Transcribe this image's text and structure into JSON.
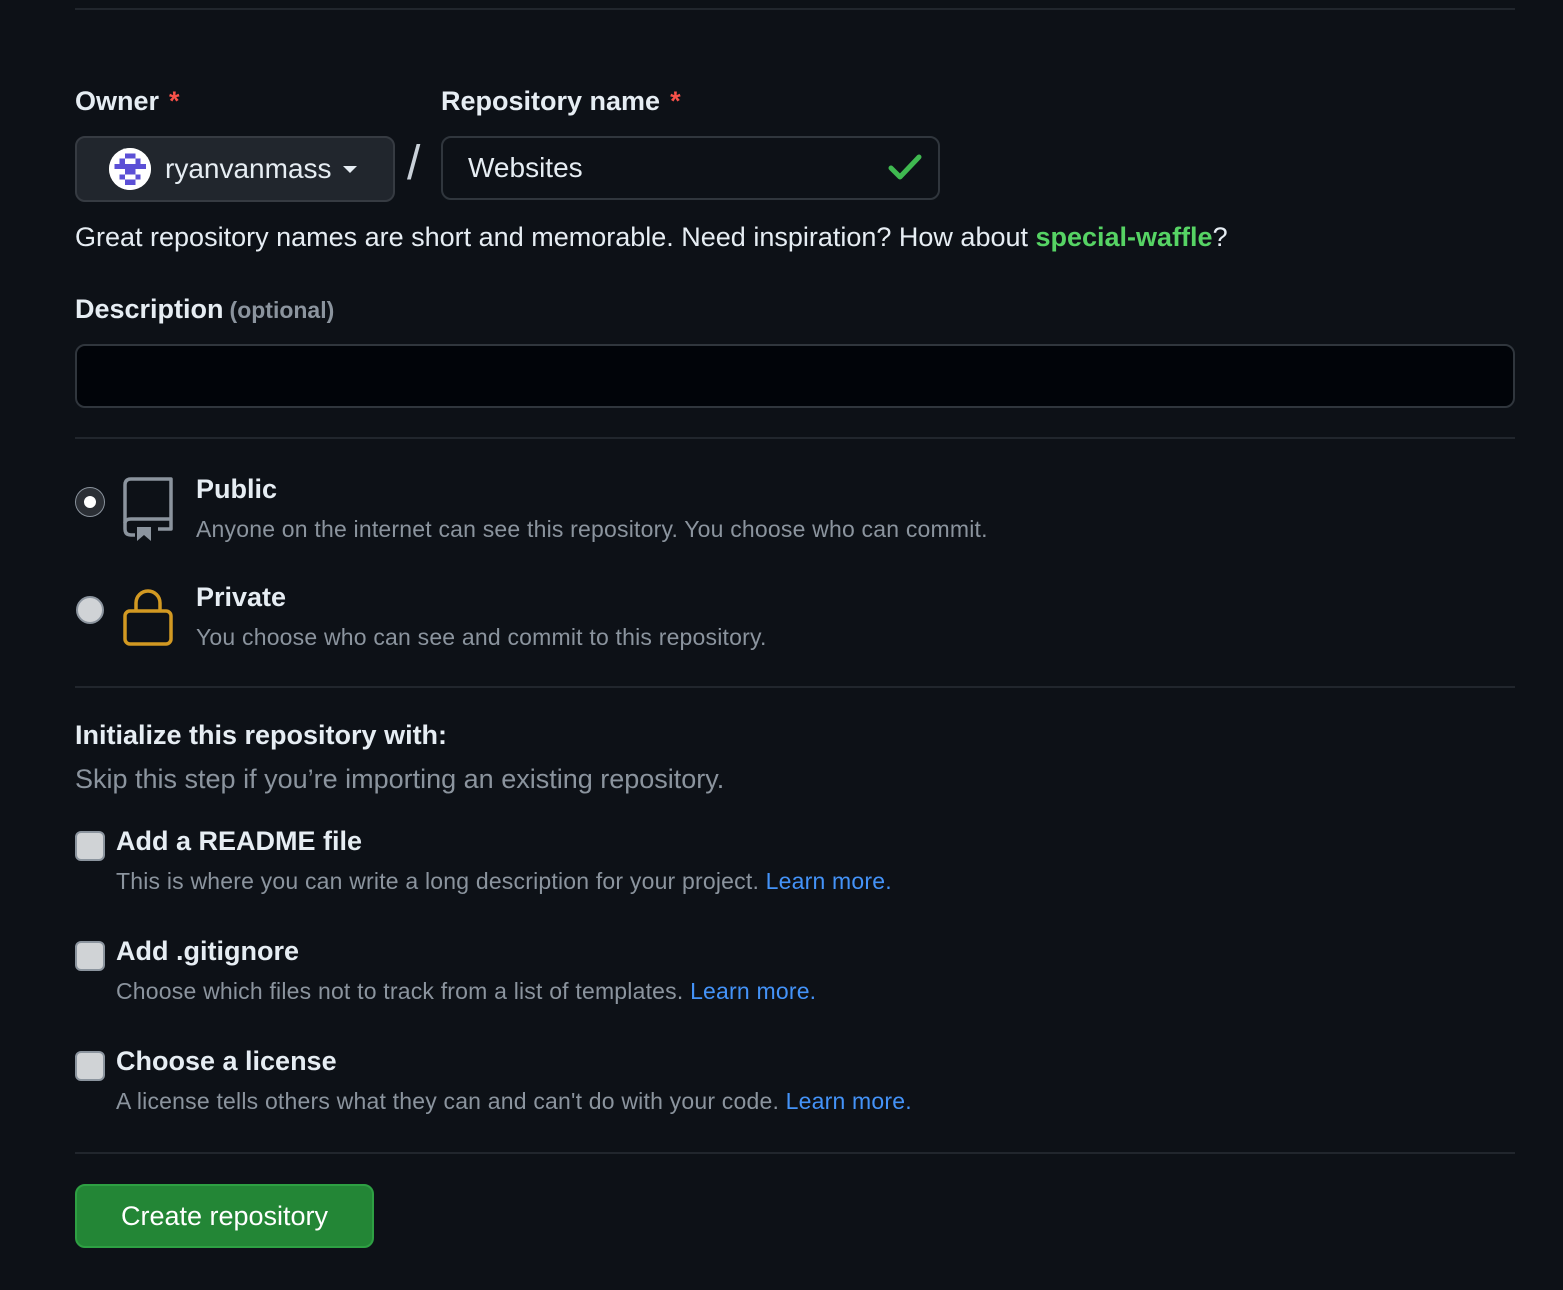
{
  "owner": {
    "label": "Owner",
    "required_mark": "*",
    "selected": "ryanvanmass"
  },
  "separator": "/",
  "repo_name": {
    "label": "Repository name",
    "required_mark": "*",
    "value": "Websites"
  },
  "hint": {
    "prefix": "Great repository names are short and memorable. Need inspiration? How about ",
    "suggestion": "special-waffle",
    "suffix": "?"
  },
  "description": {
    "label": "Description",
    "optional": "(optional)",
    "value": ""
  },
  "visibility": {
    "selected": "public",
    "options": [
      {
        "title": "Public",
        "desc": "Anyone on the internet can see this repository. You choose who can commit.",
        "icon": "repo-icon"
      },
      {
        "title": "Private",
        "desc": "You choose who can see and commit to this repository.",
        "icon": "lock-icon"
      }
    ]
  },
  "init": {
    "title": "Initialize this repository with:",
    "subtitle": "Skip this step if you’re importing an existing repository.",
    "options": [
      {
        "title": "Add a README file",
        "desc": "This is where you can write a long description for your project. ",
        "link": "Learn more.",
        "checked": false
      },
      {
        "title": "Add .gitignore",
        "desc": "Choose which files not to track from a list of templates. ",
        "link": "Learn more.",
        "checked": false
      },
      {
        "title": "Choose a license",
        "desc": "A license tells others what they can and can't do with your code. ",
        "link": "Learn more.",
        "checked": false
      }
    ]
  },
  "create_button": "Create repository",
  "colors": {
    "background": "#0d1117",
    "primary_button": "#238636",
    "link": "#4493f8",
    "suggestion": "#56d364",
    "required": "#f85149",
    "lock": "#d29922",
    "check": "#3fb950"
  }
}
